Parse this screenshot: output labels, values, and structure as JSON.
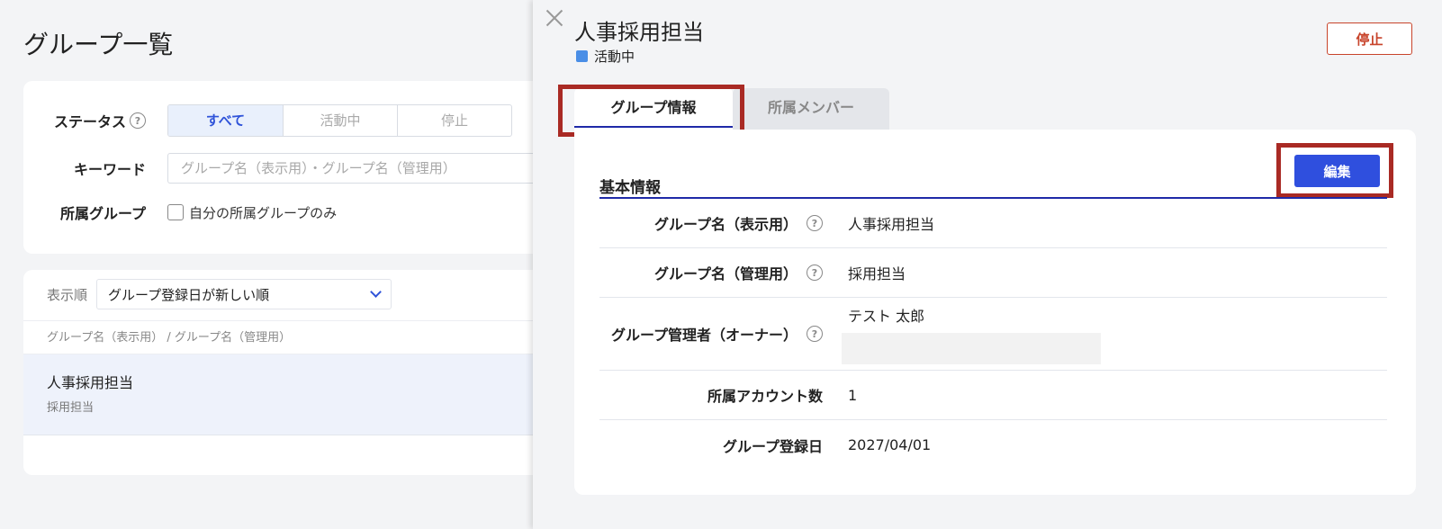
{
  "list_page": {
    "title": "グループ一覧",
    "filters": {
      "status_label": "ステータス",
      "status_options": [
        "すべて",
        "活動中",
        "停止"
      ],
      "status_selected": "すべて",
      "keyword_label": "キーワード",
      "keyword_placeholder": "グループ名（表示用）・グループ名（管理用）",
      "membership_label": "所属グループ",
      "membership_checkbox_label": "自分の所属グループのみ"
    },
    "sort": {
      "label": "表示順",
      "selected": "グループ登録日が新しい順"
    },
    "columns_header": "グループ名（表示用） / グループ名（管理用）",
    "rows": [
      {
        "display_name": "人事採用担当",
        "admin_name": "採用担当"
      }
    ]
  },
  "drawer": {
    "title": "人事採用担当",
    "status_text": "活動中",
    "status_color": "#4a8ee6",
    "stop_label": "停止",
    "tabs": [
      {
        "label": "グループ情報",
        "active": true
      },
      {
        "label": "所属メンバー",
        "active": false
      }
    ],
    "edit_label": "編集",
    "section_title": "基本情報",
    "fields": [
      {
        "label": "グループ名（表示用）",
        "value": "人事採用担当",
        "help": true
      },
      {
        "label": "グループ名（管理用）",
        "value": "採用担当",
        "help": true
      },
      {
        "label": "グループ管理者（オーナー）",
        "value": "テスト 太郎",
        "help": true
      },
      {
        "label": "所属アカウント数",
        "value": "1",
        "help": false
      },
      {
        "label": "グループ登録日",
        "value": "2027/04/01",
        "help": false
      }
    ]
  },
  "colors": {
    "accent": "#2f4fde",
    "danger": "#c8442b",
    "highlight": "#a92a24"
  }
}
